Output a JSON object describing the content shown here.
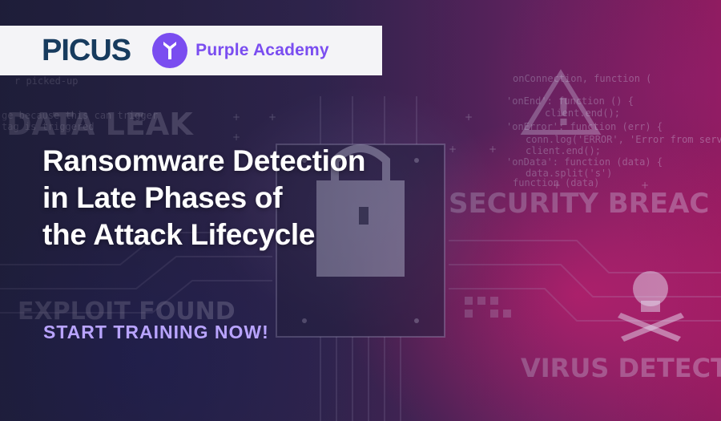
{
  "brand": {
    "picus_logo": "PICUS",
    "academy_name": "Purple Academy",
    "academy_icon": "purple-academy-icon",
    "accent_color": "#7a4df0",
    "picus_color": "#173b5e"
  },
  "headline": {
    "line1": "Ransomware Detection",
    "line2": "in Late Phases of",
    "line3": "the Attack Lifecycle"
  },
  "cta": {
    "label": "START TRAINING NOW!",
    "color": "#b9a4ff"
  },
  "background_text": {
    "data_leak": "DATA LEAK",
    "security_breach": "SECURITY BREAC",
    "exploit_found": "EXPLOIT FOUND",
    "virus_detected": "VIRUS DETECT",
    "code_top_left": "r picked-up",
    "code_left_1": "ge because this can trigger",
    "code_left_2": "tag is triggered",
    "code_right_1": "onConnection, function (",
    "code_right_2": "'onEnd': function () {",
    "code_right_3": "client.end();",
    "code_right_4": "'onError': function (err) {",
    "code_right_5": "conn.log('ERROR', 'Error from serve",
    "code_right_6": "client.end();",
    "code_right_7": "'onData': function (data) {",
    "code_right_8": "data.split('s')",
    "code_right_9": "function (data)"
  }
}
